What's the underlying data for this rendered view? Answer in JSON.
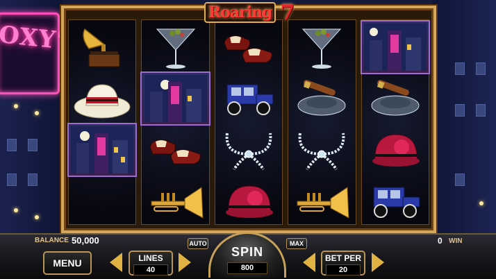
{
  "game": {
    "logo_word": "Roaring",
    "logo_number": "7",
    "background_sign": "OXY'S"
  },
  "reels": [
    [
      "gramophone",
      "straw-hat",
      "city-night"
    ],
    [
      "martini",
      "city-night",
      "dance-shoes",
      "trumpet"
    ],
    [
      "dance-shoes",
      "vintage-car",
      "pearl-necklace",
      "cloche-hat"
    ],
    [
      "martini",
      "cigar-ashtray",
      "pearl-necklace",
      "trumpet"
    ],
    [
      "city-night",
      "cigar-ashtray",
      "cloche-hat",
      "vintage-car"
    ]
  ],
  "controls": {
    "balance_label": "BALANCE",
    "balance_value": "50,000",
    "win_value": "0",
    "win_label": "WIN",
    "menu_label": "MENU",
    "lines_label": "LINES",
    "lines_value": "40",
    "auto_label": "AUTO",
    "spin_label": "SPIN",
    "spin_value": "800",
    "max_label": "MAX",
    "bet_per_label": "BET PER",
    "bet_per_value": "20"
  },
  "colors": {
    "frame_gold": "#d6a65a",
    "arrow_gold": "#e0b243",
    "neon_pink": "#ff4fb8",
    "logo_red": "#ff3a34"
  }
}
